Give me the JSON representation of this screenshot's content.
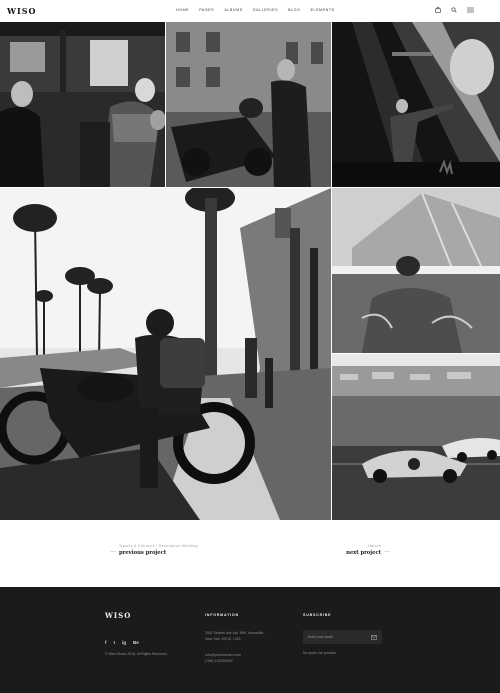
{
  "header": {
    "logo": "WISO",
    "nav": [
      "HOME",
      "PAGES",
      "ALBUMS",
      "GALLERIES",
      "BLOG",
      "ELEMENTS"
    ],
    "icons": [
      "bag-icon",
      "search-icon",
      "menu-icon"
    ]
  },
  "navigation": {
    "prev_meta": "Travels & Entrance / Description Wedding",
    "prev_label": "previous project",
    "next_meta": "Nature",
    "next_label": "next project"
  },
  "footer": {
    "logo": "WISO",
    "social": [
      "f",
      "t",
      "ig",
      "Be"
    ],
    "copyright": "© Wiso Studio 2018. All Rights Reserved.",
    "info_heading": "INFORMATION",
    "address_line1": "2502 Stokes Isle Apt. 896, Vernaville,",
    "address_line2": "New York 10010, USA",
    "email": "info@yourdomain.com",
    "phone": "(+68) 120034509",
    "subscribe_heading": "SUBSCRIBE",
    "email_placeholder": "Enter your email",
    "no_spam": "No spam, we promise"
  },
  "colors": {
    "footer_bg": "#1b1b1b",
    "text": "#222222"
  }
}
